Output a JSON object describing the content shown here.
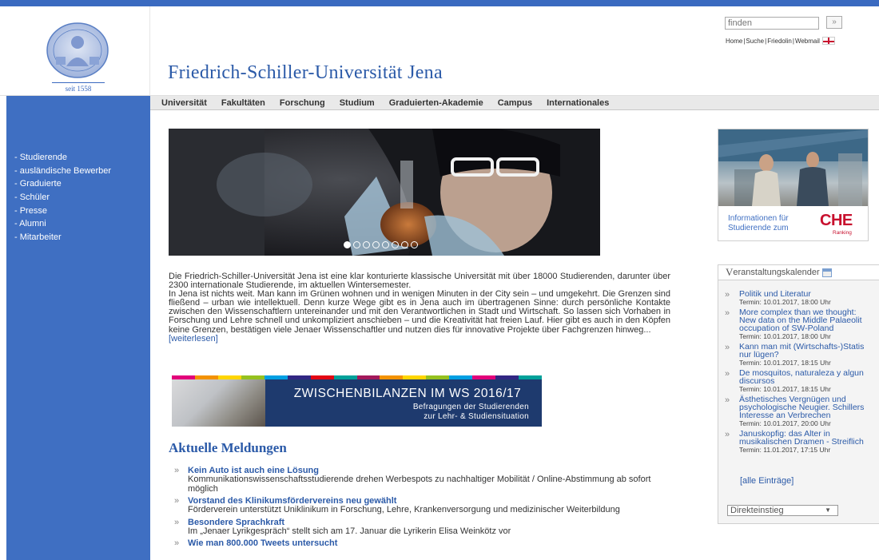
{
  "header": {
    "seal_text": "seit 1558",
    "site_title": "Friedrich-Schiller-Universität Jena",
    "search_placeholder": "finden",
    "search_button": "»",
    "top_links": [
      "Home",
      "Suche",
      "Friedolin",
      "Webmail"
    ]
  },
  "main_nav": [
    "Universität",
    "Fakultäten",
    "Forschung",
    "Studium",
    "Graduierten-Akademie",
    "Campus",
    "Internationales"
  ],
  "sidebar": {
    "items": [
      "- Studierende",
      "- ausländische Bewerber",
      "- Graduierte",
      "- Schüler",
      "- Presse",
      "- Alumni",
      "- Mitarbeiter"
    ]
  },
  "slider": {
    "active_index": 0,
    "count": 8
  },
  "intro": {
    "p1": "Die Friedrich-Schiller-Universität Jena ist eine klar konturierte klassische Universität mit über 18000 Studierenden, darunter über 2300 internationale Studierende, im aktuellen Wintersemester.",
    "p2": "In Jena ist nichts weit. Man kann im Grünen wohnen und in wenigen Minuten in der City sein – und umgekehrt. Die Grenzen sind fließend – urban wie intellektuell. Denn kurze Wege gibt es in Jena auch im übertragenen Sinne: durch persönliche Kontakte zwischen den Wissenschaftlern untereinander und mit den Verantwortlichen in Stadt und Wirtschaft. So lassen sich Vorhaben in Forschung und Lehre schnell und unkompliziert anschieben – und die Kreativität hat freien Lauf. Hier gibt es auch in den Köpfen keine Grenzen, bestätigen viele Jenaer Wissenschaftler und nutzen dies für innovative Projekte über Fachgrenzen hinweg...",
    "more": "[weiterlesen]"
  },
  "banner": {
    "title": "ZWISCHENBILANZEN IM WS 2016/17",
    "line1": "Befragungen der Studierenden",
    "line2": "zur Lehr- & Studiensituation",
    "stripe_colors": [
      "#e2007a",
      "#f39200",
      "#ffd500",
      "#95c11f",
      "#009fe3",
      "#312783",
      "#e30613",
      "#00a19a",
      "#a3195b",
      "#f39200",
      "#ffd500",
      "#95c11f",
      "#009fe3",
      "#e2007a",
      "#312783",
      "#00a19a"
    ]
  },
  "news": {
    "heading": "Aktuelle Meldungen",
    "items": [
      {
        "title": "Kein Auto ist auch eine Lösung",
        "desc": "Kommunikationswissenschaftsstudierende drehen Werbespots zu nachhaltiger Mobilität / Online-Abstimmung ab sofort möglich"
      },
      {
        "title": "Vorstand des Klinikumsfördervereins neu gewählt",
        "desc": "Förderverein unterstützt Uniklinikum in Forschung, Lehre, Krankenversorgung und medizinischer Weiterbildung"
      },
      {
        "title": "Besondere Sprachkraft",
        "desc": "Im „Jenaer Lyrikgespräch“ stellt sich am 17. Januar die Lyrikerin Elisa Weinkötz vor"
      },
      {
        "title": "Wie man 800.000 Tweets untersucht",
        "desc": ""
      }
    ]
  },
  "che": {
    "line1": "Informationen für",
    "line2": "Studierende zum",
    "logo": "CHE",
    "ranking": "Ranking"
  },
  "calendar": {
    "heading_first": "V",
    "heading_rest": "eranstaltungskalender",
    "events": [
      {
        "lines": [
          "Politik und Literatur"
        ],
        "date": "Termin: 10.01.2017, 18:00 Uhr"
      },
      {
        "lines": [
          "More complex than we thought:",
          "New data on the Middle Palaeolit",
          "occupation of SW-Poland"
        ],
        "date": "Termin: 10.01.2017, 18:00 Uhr"
      },
      {
        "lines": [
          "Kann man mit (Wirtschafts-)Statis",
          "nur lügen?"
        ],
        "date": "Termin: 10.01.2017, 18:15 Uhr"
      },
      {
        "lines": [
          "De mosquitos, naturaleza y algun",
          "discursos"
        ],
        "date": "Termin: 10.01.2017, 18:15 Uhr"
      },
      {
        "lines": [
          "Ästhetisches Vergnügen und",
          "psychologische Neugier. Schillers",
          "Interesse an Verbrechen"
        ],
        "date": "Termin: 10.01.2017, 20:00 Uhr"
      },
      {
        "lines": [
          "Januskopfig: das Alter in",
          "musikalischen Dramen - Streiflich"
        ],
        "date": "Termin: 11.01.2017, 17:15 Uhr"
      }
    ],
    "all_entries": "[alle Einträge]"
  },
  "quick_access": {
    "selected": "Direkteinstieg"
  }
}
